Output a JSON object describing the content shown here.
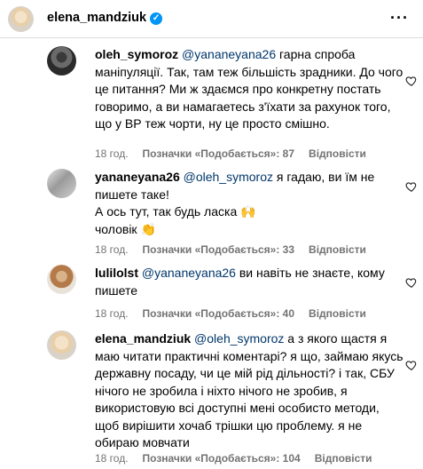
{
  "header": {
    "username": "elena_mandziuk",
    "more": "···"
  },
  "comments": [
    {
      "username": "oleh_symoroz",
      "mention": "@yananeyana26",
      "body": " гарна спроба маніпуляції. Так, там теж більшість зрадники. До чого це питання? Ми ж здаємся про конкретну постать говоримо, а ви намагаетесь з'їхати за рахунок того, що у ВР теж чорти, ну це просто смішно.",
      "time": "18 год.",
      "likes": "Позначки «Подобається»: 87",
      "reply": "Відповісти"
    },
    {
      "username": "yananeyana26",
      "mention": "@oleh_symoroz",
      "body": " я гадаю, ви їм не пишете таке!",
      "body2": "А ось тут, так будь ласка 🙌",
      "body3": "чоловік 👏",
      "time": "18 год.",
      "likes": "Позначки «Подобається»: 33",
      "reply": "Відповісти"
    },
    {
      "username": "lulilolst",
      "mention": "@yananeyana26",
      "body": " ви навіть не знаєте, кому пишете",
      "time": "18 год.",
      "likes": "Позначки «Подобається»: 40",
      "reply": "Відповісти"
    },
    {
      "username": "elena_mandziuk",
      "mention": "@oleh_symoroz",
      "body": " а з якого щастя я маю читати практичні коментарі? я що, займаю якусь державну посаду, чи це мій рід дільності? і так, СБУ нічого не зробила і ніхто нічого не зробив, я використовую всі доступні мені особисто методи, щоб вирішити хочаб трішки цю проблему. я не обираю мовчати",
      "time": "18 год.",
      "likes": "Позначки «Подобається»: 104",
      "reply": "Відповісти"
    }
  ]
}
